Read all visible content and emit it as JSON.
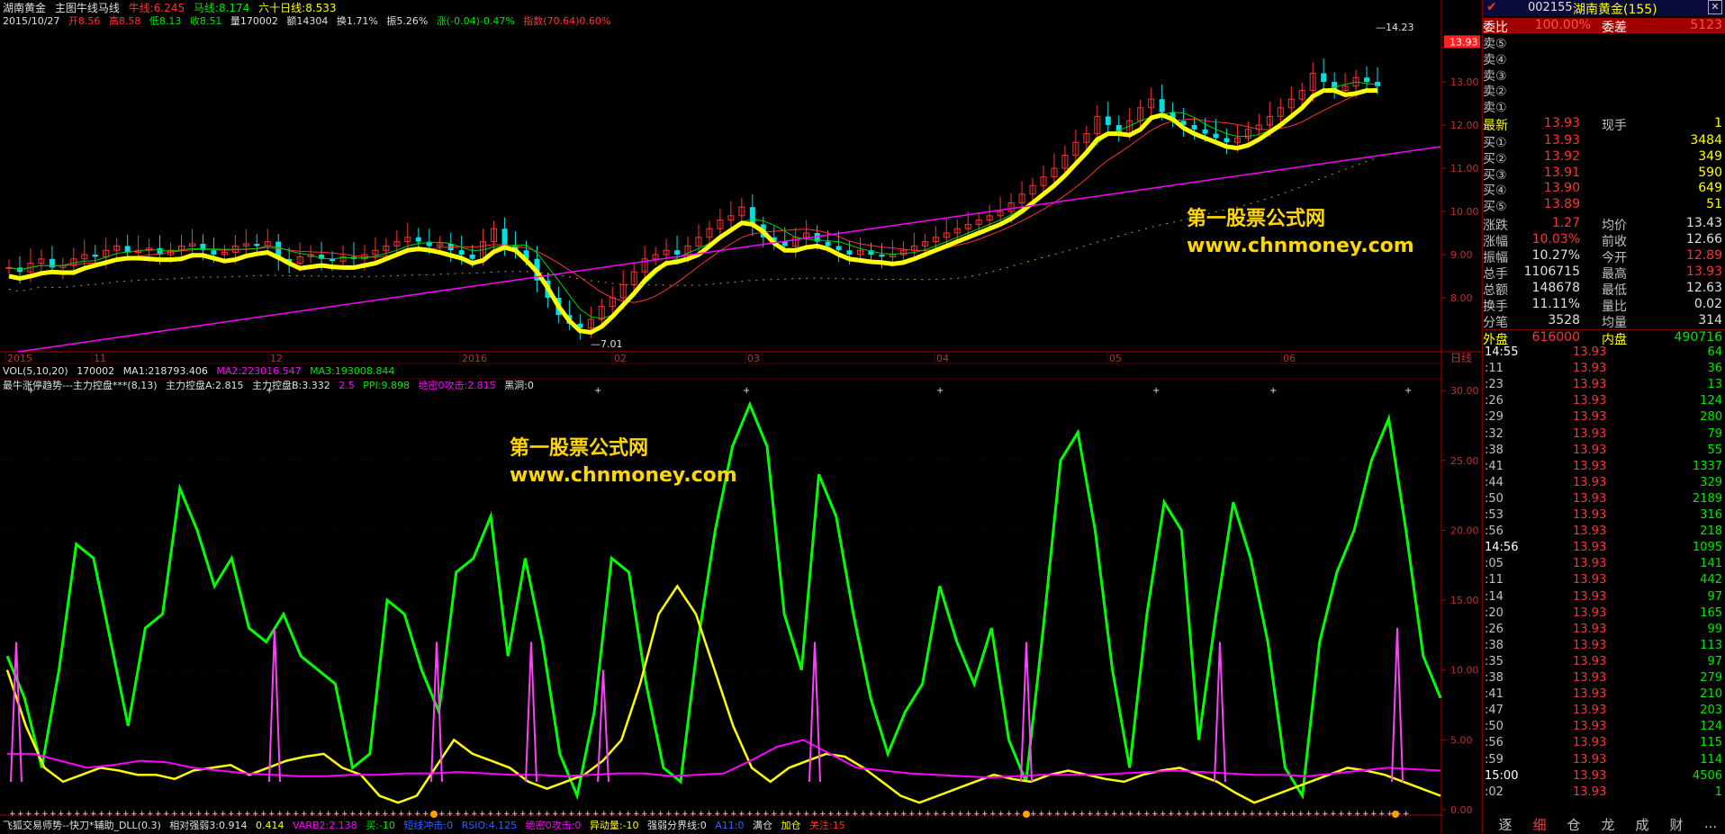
{
  "header": {
    "stock_name": "湖南黄金",
    "indicator": "主图牛线马线",
    "niu_label": "牛线:6.245",
    "ma_label": "马线:8.174",
    "liu_label": "六十日线:8.533",
    "date": "2015/10/27",
    "open": "开8.56",
    "high": "高8.58",
    "low": "低8.13",
    "close": "收8.51",
    "vol": "量170002",
    "amount": "额14304",
    "turnover": "换1.71%",
    "amp": "振5.26%",
    "change": "涨(-0.04)-0.47%",
    "index": "指数(70.64)0.60%"
  },
  "price_axis": [
    "13.00",
    "12.00",
    "11.00",
    "10.00",
    "9.00",
    "8.00"
  ],
  "price_current": "13.93",
  "price_high_label": "14.23",
  "price_low_label": "7.01",
  "date_axis": [
    "2015",
    "11",
    "12",
    "2016",
    "02",
    "03",
    "04",
    "05",
    "06"
  ],
  "period_label": "日线",
  "watermark1": {
    "line1": "第一股票公式网",
    "line2": "www.chnmoney.com"
  },
  "watermark2": {
    "line1": "第一股票公式网",
    "line2": "www.chnmoney.com"
  },
  "vol_line": {
    "name": "VOL(5,10,20)",
    "v": "170002",
    "ma1": "MA1:218793.406",
    "ma2": "MA2:223016.547",
    "ma3": "MA3:193008.844"
  },
  "ind_line": {
    "name": "最牛涨停趋势---主力控盘***(8,13)",
    "a": "主力控盘A:2.815",
    "b": "主力控盘B:3.332",
    "c": "2.5",
    "ppi": "PPI:9.898",
    "abs": "绝密0攻击:2.815",
    "hd": "黑洞:0"
  },
  "ind_axis": [
    "30.00",
    "25.00",
    "20.00",
    "15.00",
    "10.00",
    "5.00",
    "0.00"
  ],
  "footer": {
    "name": "飞狐交易师势--快刀*辅助_DLL(0.3)",
    "xd": "相对强弱3:0.914",
    "v2": "0.414",
    "varb": "VARB2:2.138",
    "buy": "买:-10",
    "jm": "短线冲击:0",
    "rsio": "RSIO:4.125",
    "jm0": "绝密0攻击:0",
    "ydl": "异动量:-10",
    "qrf": "强弱分界线:0",
    "a11": "A11:0",
    "qx": "满仓",
    "jc": "加仓",
    "gz": "关注:15"
  },
  "quote": {
    "code": "002155",
    "name": "湖南黄金(155)",
    "weibi_label": "委比",
    "weibi": "100.00%",
    "weicha_label": "委差",
    "weicha": "5123",
    "sell": [
      {
        "label": "卖⑤",
        "price": "",
        "vol": ""
      },
      {
        "label": "卖④",
        "price": "",
        "vol": ""
      },
      {
        "label": "卖③",
        "price": "",
        "vol": ""
      },
      {
        "label": "卖②",
        "price": "",
        "vol": ""
      },
      {
        "label": "卖①",
        "price": "",
        "vol": ""
      }
    ],
    "last_label": "最新",
    "last": "13.93",
    "xs_label": "现手",
    "xs": "1",
    "buy": [
      {
        "label": "买①",
        "price": "13.93",
        "vol": "3484"
      },
      {
        "label": "买②",
        "price": "13.92",
        "vol": "349"
      },
      {
        "label": "买③",
        "price": "13.91",
        "vol": "590"
      },
      {
        "label": "买④",
        "price": "13.90",
        "vol": "649"
      },
      {
        "label": "买⑤",
        "price": "13.89",
        "vol": "51"
      }
    ],
    "stats": [
      {
        "l1": "涨跌",
        "v1": "1.27",
        "c1": "red",
        "l2": "均价",
        "v2": "13.43",
        "c2": "white"
      },
      {
        "l1": "涨幅",
        "v1": "10.03%",
        "c1": "red",
        "l2": "前收",
        "v2": "12.66",
        "c2": "white"
      },
      {
        "l1": "振幅",
        "v1": "10.27%",
        "c1": "white",
        "l2": "今开",
        "v2": "12.89",
        "c2": "red"
      },
      {
        "l1": "总手",
        "v1": "1106715",
        "c1": "white",
        "l2": "最高",
        "v2": "13.93",
        "c2": "red"
      },
      {
        "l1": "总额",
        "v1": "148678",
        "c1": "white",
        "l2": "最低",
        "v2": "12.63",
        "c2": "white"
      },
      {
        "l1": "换手",
        "v1": "11.11%",
        "c1": "white",
        "l2": "量比",
        "v2": "0.02",
        "c2": "white"
      },
      {
        "l1": "分笔",
        "v1": "3528",
        "c1": "white",
        "l2": "均量",
        "v2": "314",
        "c2": "white"
      }
    ],
    "outer_label": "外盘",
    "outer": "616000",
    "inner_label": "内盘",
    "inner": "490716"
  },
  "ticks": [
    {
      "t": "14:55",
      "p": "13.93",
      "v": "64",
      "c": "green"
    },
    {
      "t": ":11",
      "p": "13.93",
      "v": "36",
      "c": "green"
    },
    {
      "t": ":23",
      "p": "13.93",
      "v": "13",
      "c": "green"
    },
    {
      "t": ":26",
      "p": "13.93",
      "v": "124",
      "c": "green"
    },
    {
      "t": ":29",
      "p": "13.93",
      "v": "280",
      "c": "green"
    },
    {
      "t": ":32",
      "p": "13.93",
      "v": "79",
      "c": "green"
    },
    {
      "t": ":38",
      "p": "13.93",
      "v": "55",
      "c": "green"
    },
    {
      "t": ":41",
      "p": "13.93",
      "v": "1337",
      "c": "green"
    },
    {
      "t": ":44",
      "p": "13.93",
      "v": "329",
      "c": "green"
    },
    {
      "t": ":50",
      "p": "13.93",
      "v": "2189",
      "c": "green"
    },
    {
      "t": ":53",
      "p": "13.93",
      "v": "316",
      "c": "green"
    },
    {
      "t": ":56",
      "p": "13.93",
      "v": "218",
      "c": "green"
    },
    {
      "t": "14:56",
      "p": "13.93",
      "v": "1095",
      "c": "green"
    },
    {
      "t": ":05",
      "p": "13.93",
      "v": "141",
      "c": "green"
    },
    {
      "t": ":11",
      "p": "13.93",
      "v": "442",
      "c": "green"
    },
    {
      "t": ":14",
      "p": "13.93",
      "v": "97",
      "c": "green"
    },
    {
      "t": ":20",
      "p": "13.93",
      "v": "165",
      "c": "green"
    },
    {
      "t": ":26",
      "p": "13.93",
      "v": "99",
      "c": "green"
    },
    {
      "t": ":38",
      "p": "13.93",
      "v": "113",
      "c": "green"
    },
    {
      "t": ":35",
      "p": "13.93",
      "v": "97",
      "c": "green"
    },
    {
      "t": ":38",
      "p": "13.93",
      "v": "279",
      "c": "green"
    },
    {
      "t": ":41",
      "p": "13.93",
      "v": "210",
      "c": "green"
    },
    {
      "t": ":47",
      "p": "13.93",
      "v": "203",
      "c": "green"
    },
    {
      "t": ":50",
      "p": "13.93",
      "v": "124",
      "c": "green"
    },
    {
      "t": ":56",
      "p": "13.93",
      "v": "115",
      "c": "green"
    },
    {
      "t": ":59",
      "p": "13.93",
      "v": "114",
      "c": "green"
    },
    {
      "t": "15:00",
      "p": "13.93",
      "v": "4506",
      "c": "green"
    },
    {
      "t": ":02",
      "p": "13.93",
      "v": "1",
      "c": "green"
    }
  ],
  "bottom_tabs": [
    "逐",
    "细",
    "仓",
    "龙",
    "成",
    "财",
    "..."
  ],
  "colors": {
    "up": "#ff3232",
    "down": "#00ffff",
    "ma_yellow": "#ffff00",
    "line_green": "#00ff00",
    "line_magenta": "#ff00ff",
    "axis": "#c00000"
  }
}
